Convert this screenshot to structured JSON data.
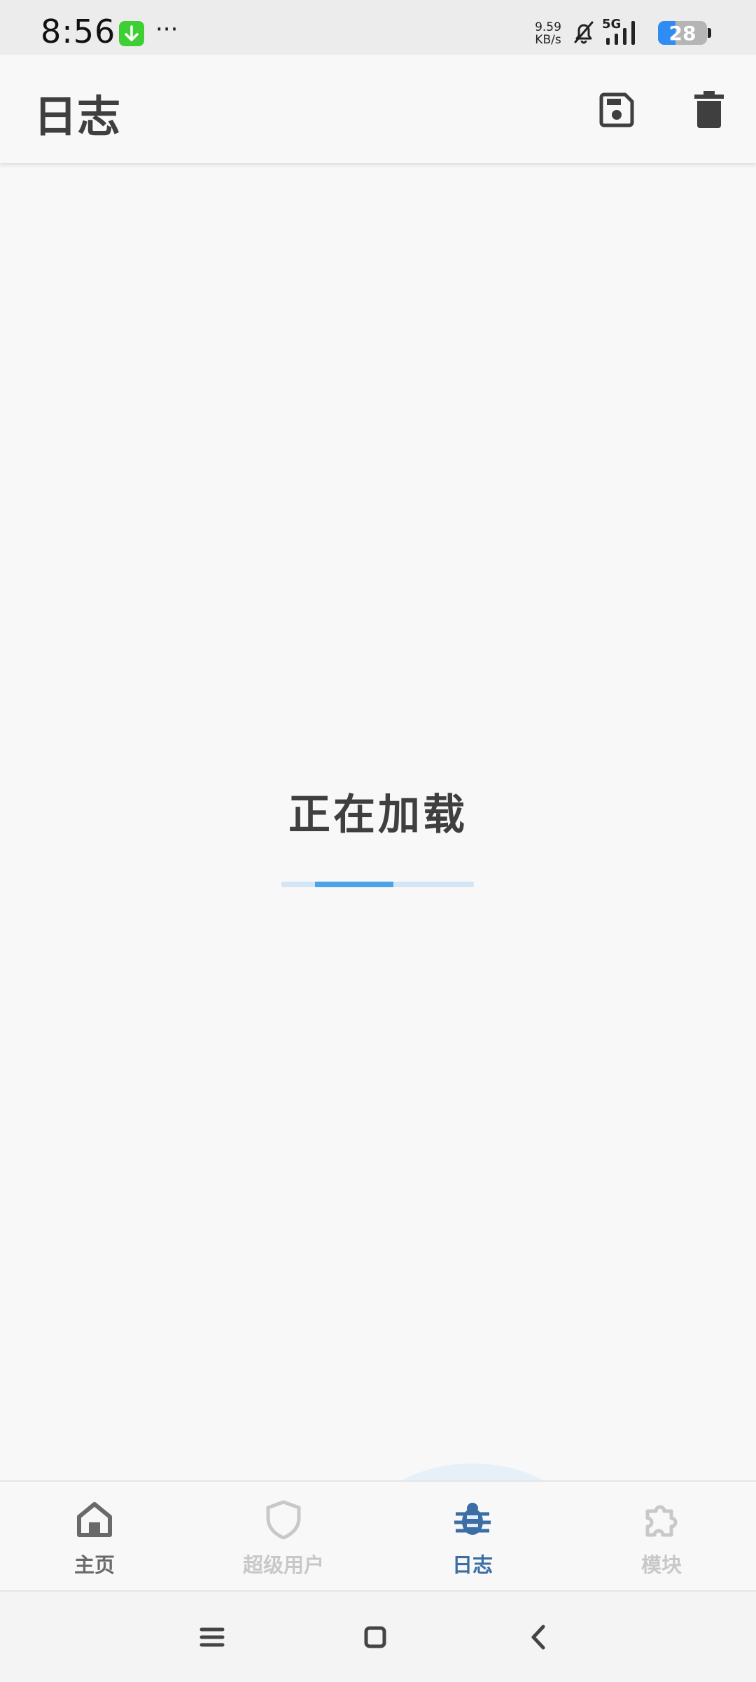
{
  "status_bar": {
    "time": "8:56",
    "more_indicator": "···",
    "net_speed_value": "9.59",
    "net_speed_unit": "KB/s",
    "network": "5G",
    "battery": "28",
    "icons": [
      "download-icon",
      "bell-off-icon",
      "signal-icon",
      "battery-icon"
    ]
  },
  "app_bar": {
    "title": "日志",
    "actions": [
      {
        "name": "save",
        "icon": "save-icon"
      },
      {
        "name": "delete",
        "icon": "trash-icon"
      }
    ]
  },
  "main": {
    "loading_text": "正在加载",
    "progress_fraction": 0.4
  },
  "bottom_nav": {
    "items": [
      {
        "label": "主页",
        "icon": "home-icon",
        "active": false
      },
      {
        "label": "超级用户",
        "icon": "shield-icon",
        "active": false
      },
      {
        "label": "日志",
        "icon": "bug-icon",
        "active": true
      },
      {
        "label": "模块",
        "icon": "puzzle-icon",
        "active": false
      }
    ],
    "colors": {
      "active": "#3a6ea5",
      "inactive": "#c8c8c8",
      "home": "#6a6a6a"
    }
  },
  "system_nav": {
    "buttons": [
      "menu-icon",
      "home-square-icon",
      "back-icon"
    ]
  },
  "colors": {
    "background": "#f8f8f8",
    "progress_track": "#d4e6f6",
    "progress_bar": "#4ba4e8",
    "text": "#3f3f3f"
  }
}
